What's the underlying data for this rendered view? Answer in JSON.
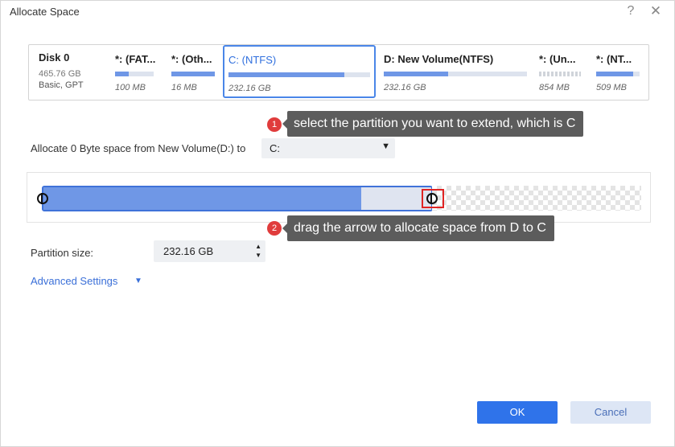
{
  "window": {
    "title": "Allocate Space",
    "help_label": "?",
    "close_label": "✕"
  },
  "disk": {
    "name": "Disk 0",
    "capacity": "465.76 GB",
    "type": "Basic, GPT",
    "partitions": [
      {
        "name": "*: (FAT...",
        "size": "100 MB",
        "used_fraction": 0.35
      },
      {
        "name": "*: (Oth...",
        "size": "16 MB",
        "used_fraction": 1.0
      },
      {
        "name": "C: (NTFS)",
        "size": "232.16 GB",
        "used_fraction": 0.82,
        "selected": true
      },
      {
        "name": "D: New Volume(NTFS)",
        "size": "232.16 GB",
        "used_fraction": 0.45
      },
      {
        "name": "*: (Un...",
        "size": "854 MB",
        "used_fraction": 0,
        "unallocated": true
      },
      {
        "name": "*: (NT...",
        "size": "509 MB",
        "used_fraction": 0.85
      }
    ]
  },
  "tips": [
    {
      "number": "1",
      "text": "select the partition you want to extend, which is C"
    },
    {
      "number": "2",
      "text": "drag the arrow to allocate space from D to C"
    }
  ],
  "allocate": {
    "label": "Allocate 0 Byte space from New Volume(D:) to",
    "target": "C:",
    "arrow": "▼"
  },
  "slider": {
    "used_fraction": 0.82
  },
  "partition_size": {
    "label": "Partition size:",
    "value": "232.16 GB",
    "up": "▲",
    "down": "▼"
  },
  "advanced": {
    "label": "Advanced Settings",
    "arrow": "▼"
  },
  "buttons": {
    "ok": "OK",
    "cancel": "Cancel"
  },
  "colors": {
    "accent": "#2f73ea",
    "bar_fill": "#6f97e6",
    "tip_bg": "#5c5c5c",
    "marker": "#e02424"
  }
}
